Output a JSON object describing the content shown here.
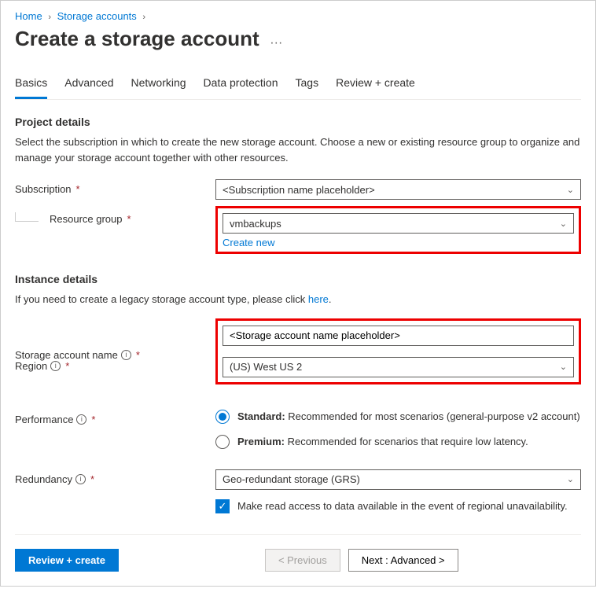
{
  "breadcrumb": {
    "home": "Home",
    "storage": "Storage accounts"
  },
  "page": {
    "title": "Create a storage account"
  },
  "tabs": [
    "Basics",
    "Advanced",
    "Networking",
    "Data protection",
    "Tags",
    "Review + create"
  ],
  "project": {
    "title": "Project details",
    "desc": "Select the subscription in which to create the new storage account. Choose a new or existing resource group to organize and manage your storage account together with other resources.",
    "subscription_label": "Subscription",
    "subscription_value": "<Subscription name placeholder>",
    "rg_label": "Resource group",
    "rg_value": "vmbackups",
    "create_new": "Create new"
  },
  "instance": {
    "title": "Instance details",
    "desc_prefix": "If you need to create a legacy storage account type, please click ",
    "desc_link": "here",
    "desc_suffix": ".",
    "name_label": "Storage account name",
    "name_value": "<Storage account name placeholder>",
    "region_label": "Region",
    "region_value": "(US) West US 2",
    "perf_label": "Performance",
    "perf_std_bold": "Standard:",
    "perf_std_text": " Recommended for most scenarios (general-purpose v2 account)",
    "perf_prem_bold": "Premium:",
    "perf_prem_text": " Recommended for scenarios that require low latency.",
    "redundancy_label": "Redundancy",
    "redundancy_value": "Geo-redundant storage (GRS)",
    "ra_checkbox": "Make read access to data available in the event of regional unavailability."
  },
  "footer": {
    "review": "Review + create",
    "prev": "< Previous",
    "next": "Next : Advanced >"
  }
}
